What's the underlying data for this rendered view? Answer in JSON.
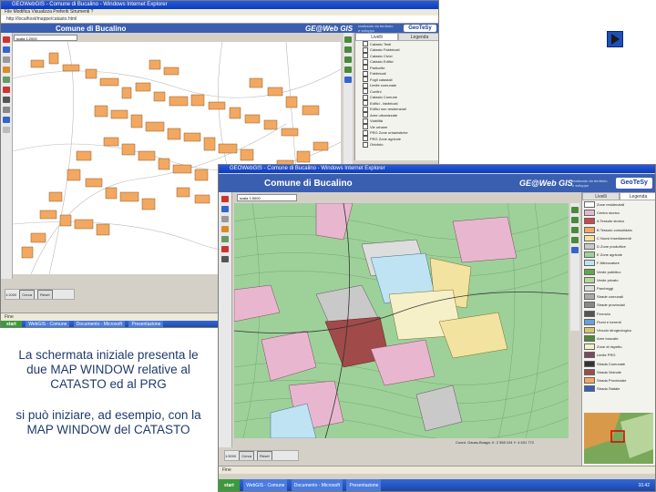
{
  "window_catasto": {
    "title": "GEOWebGIS - Comune di Bucalino - Windows Internet Explorer",
    "menu": "File   Modifica   Visualizza   Preferiti   Strumenti   ?",
    "address": "http://localhost/mappe/catasto.html",
    "app_title": "Comune di Bucalino",
    "product_logo": "GE@Web GIS",
    "product_sub": "realizzato da territorio e sviluppo",
    "company_logo": "GeoTeSy",
    "zoom_select": "scala 1:2000",
    "tabs": [
      "Livelli",
      "Legenda"
    ],
    "layers": [
      "Catasto Testi",
      "Catasto Fabbricati",
      "Catasto Civici",
      "Catasto Edifici",
      "Particelle",
      "Fabbricati",
      "Fogli catastali",
      "Limite comunale",
      "Confini",
      "Catasto Comune",
      "Edifici - fabbricati",
      "Edifici non residenziali",
      "Aree urbanizzate",
      "Viabilità",
      "Vie urbane",
      "PRG Zone urbanistiche",
      "PRG Zone agricole",
      "Ortofoto"
    ],
    "scale_label": "1:2000",
    "scale_button": "Cerca",
    "reset_button": "Reset",
    "status": "Fine",
    "status_zone": "Internet"
  },
  "window_prg": {
    "title": "GEOWebGIS - Comune di Bucalino - Windows Internet Explorer",
    "app_title": "Comune di Bucalino",
    "product_logo": "GE@Web GIS",
    "product_sub": "realizzato da territorio e sviluppo",
    "company_logo": "GeoTeSy",
    "zoom_select": "scala 1:5000",
    "tabs": [
      "Livelli",
      "Legenda"
    ],
    "legend": [
      "Zone residenziali",
      "Centro storico",
      "A Tessuto storico",
      "B Tessuto consolidato",
      "C Nuovi insediamenti",
      "D Zone produttive",
      "E Zone agricole",
      "F Attrezzature",
      "Verde pubblico",
      "Verde privato",
      "Parcheggi",
      "Strade comunali",
      "Strade provinciali",
      "Ferrovia",
      "Fiumi e torrenti",
      "Vincolo idrogeologico",
      "Aree boscate",
      "Zone di rispetto",
      "Limite PRG",
      "Strada Comunale",
      "Strada Vicinale",
      "Strada Provinciale",
      "Strada Statale"
    ],
    "scale_label": "1:5000",
    "scale_button": "Cerca",
    "reset_button": "Reset",
    "coord_readout": "Coord. Gauss-Boaga:  X: 2 358 104  Y: 4 631 772",
    "status": "Fine",
    "status_zone": "Internet"
  },
  "taskbar": {
    "start": "start",
    "items": [
      "WebGIS - Comune",
      "Documento - Microsoft",
      "Presentazione"
    ],
    "clock": "10.42"
  },
  "caption": {
    "p1": "La schermata iniziale presenta le due MAP WINDOW relative al CATASTO ed al PRG",
    "p2": "si può iniziare, ad esempio, con la MAP WINDOW del CATASTO"
  },
  "nav": {
    "next_icon": "next-slide-arrow-icon"
  },
  "colors": {
    "banner": "#3b5fb0",
    "building_fill": "#f2a860",
    "map_bg": "#ffffff",
    "prg_green": "#9ed19a",
    "prg_pink": "#e8b7cf",
    "caption_text": "#1f3a6b"
  }
}
